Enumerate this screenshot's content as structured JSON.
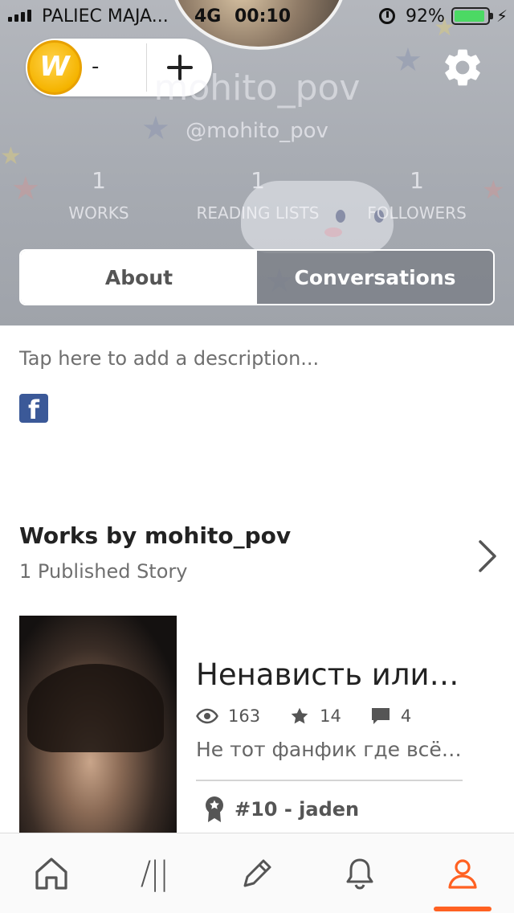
{
  "status_bar": {
    "carrier": "PALIEC MAJA...",
    "network": "4G",
    "time": "00:10",
    "battery": "92%",
    "battery_level": 0.92
  },
  "coins": {
    "logo": "W",
    "count": "-",
    "add_icon": "plus-icon"
  },
  "profile": {
    "display_name": "mohito_pov",
    "username": "@mohito_pov",
    "stats": [
      {
        "value": "1",
        "label": "WORKS"
      },
      {
        "value": "1",
        "label": "READING LISTS"
      },
      {
        "value": "1",
        "label": "FOLLOWERS"
      }
    ],
    "settings_icon": "gear-icon"
  },
  "tabs": [
    {
      "label": "About",
      "active": true
    },
    {
      "label": "Conversations",
      "active": false
    }
  ],
  "about": {
    "description_placeholder": "Tap here to add a description...",
    "social_icon": "facebook-icon",
    "facebook_glyph": "f"
  },
  "works": {
    "title": "Works by mohito_pov",
    "subtitle": "1 Published Story",
    "story": {
      "title": "Ненависть или…",
      "reads": "163",
      "votes": "14",
      "comments": "4",
      "description": "Не тот фанфик где всё…",
      "ranking": "#10 - jaden"
    }
  },
  "bottom_nav": {
    "items": [
      {
        "name": "home",
        "icon": "home-icon"
      },
      {
        "name": "library",
        "icon": "library-icon",
        "glyph": "/||"
      },
      {
        "name": "write",
        "icon": "pencil-icon"
      },
      {
        "name": "notifications",
        "icon": "bell-icon"
      },
      {
        "name": "profile",
        "icon": "person-icon",
        "active": true
      }
    ],
    "active_color": "#ff6122"
  },
  "colors": {
    "accent": "#ff6122",
    "facebook": "#3b5998",
    "coin": "#f5b400",
    "battery": "#4cd964"
  }
}
